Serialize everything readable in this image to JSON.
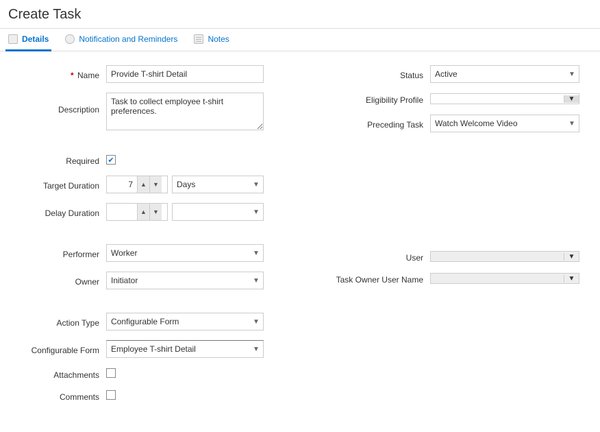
{
  "header": {
    "title": "Create Task"
  },
  "tabs": {
    "details": "Details",
    "notifications": "Notification and Reminders",
    "notes": "Notes"
  },
  "fields": {
    "name_label": "Name",
    "name_value": "Provide T-shirt Detail",
    "description_label": "Description",
    "description_value": "Task to collect employee t-shirt preferences.",
    "status_label": "Status",
    "status_value": "Active",
    "eligibility_label": "Eligibility Profile",
    "eligibility_value": "",
    "preceding_label": "Preceding Task",
    "preceding_value": "Watch Welcome Video",
    "required_label": "Required",
    "required_checked": true,
    "target_duration_label": "Target Duration",
    "target_duration_value": "7",
    "target_duration_unit": "Days",
    "delay_duration_label": "Delay Duration",
    "delay_duration_value": "",
    "delay_duration_unit": "",
    "performer_label": "Performer",
    "performer_value": "Worker",
    "owner_label": "Owner",
    "owner_value": "Initiator",
    "user_label": "User",
    "user_value": "",
    "task_owner_user_label": "Task Owner User Name",
    "task_owner_user_value": "",
    "action_type_label": "Action Type",
    "action_type_value": "Configurable Form",
    "configurable_form_label": "Configurable Form",
    "configurable_form_value": "Employee T-shirt Detail",
    "attachments_label": "Attachments",
    "attachments_checked": false,
    "comments_label": "Comments",
    "comments_checked": false
  }
}
